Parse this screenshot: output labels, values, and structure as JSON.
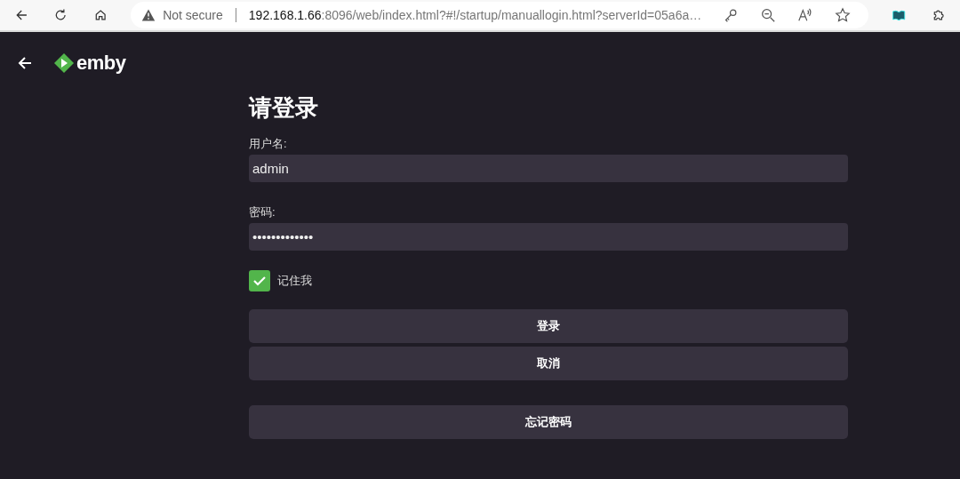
{
  "browser": {
    "security_label": "Not secure",
    "url_host": "192.168.1.66",
    "url_rest": ":8096/web/index.html?#!/startup/manuallogin.html?serverId=05a6a…"
  },
  "header": {
    "logo_text": "emby"
  },
  "form": {
    "title": "请登录",
    "fields": [
      {
        "label": "用户名:",
        "value": "admin"
      },
      {
        "label": "密码:",
        "value": "•••••••••••••"
      }
    ],
    "remember": {
      "label": "记住我",
      "checked": true
    },
    "buttons": [
      {
        "label": "登录"
      },
      {
        "label": "取消"
      }
    ],
    "secondary_buttons": [
      {
        "label": "忘记密码"
      }
    ]
  }
}
